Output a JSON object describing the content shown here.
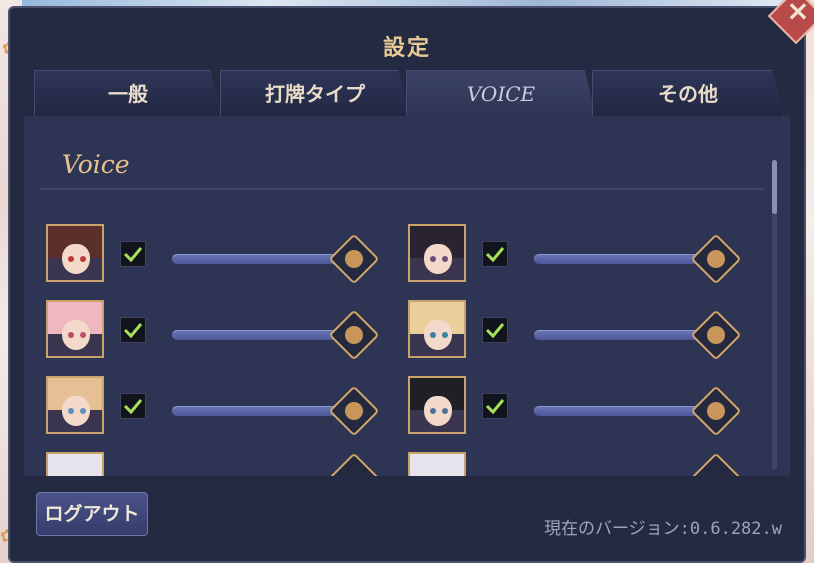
{
  "dialog": {
    "title": "設定",
    "close_glyph": "×"
  },
  "tabs": [
    {
      "label": "一般",
      "active": false
    },
    {
      "label": "打牌タイプ",
      "active": false
    },
    {
      "label": "VOICE",
      "active": true
    },
    {
      "label": "その他",
      "active": false
    }
  ],
  "voice_section": {
    "title": "Voice",
    "characters": [
      {
        "column": "left",
        "row": 1,
        "enabled": true,
        "volume": 1.0,
        "hair_color": "#5a2f2c",
        "eye_color": "#c0353a"
      },
      {
        "column": "right",
        "row": 1,
        "enabled": true,
        "volume": 1.0,
        "hair_color": "#2a2432",
        "eye_color": "#6b4a7a"
      },
      {
        "column": "left",
        "row": 2,
        "enabled": true,
        "volume": 1.0,
        "hair_color": "#f0b7c0",
        "eye_color": "#c04a6a"
      },
      {
        "column": "right",
        "row": 2,
        "enabled": true,
        "volume": 1.0,
        "hair_color": "#e9cf9a",
        "eye_color": "#3f7fa3"
      },
      {
        "column": "left",
        "row": 3,
        "enabled": true,
        "volume": 1.0,
        "hair_color": "#e6bf95",
        "eye_color": "#5a8fc0"
      },
      {
        "column": "right",
        "row": 3,
        "enabled": true,
        "volume": 1.0,
        "hair_color": "#1f1f26",
        "eye_color": "#4d6f9a"
      }
    ]
  },
  "footer": {
    "logout_label": "ログアウト",
    "version_text": "現在のバージョン:0.6.282.w"
  },
  "colors": {
    "accent_gold": "#e7c28a",
    "check_green": "#a8e05a",
    "slider_track": "#5a64a6"
  }
}
